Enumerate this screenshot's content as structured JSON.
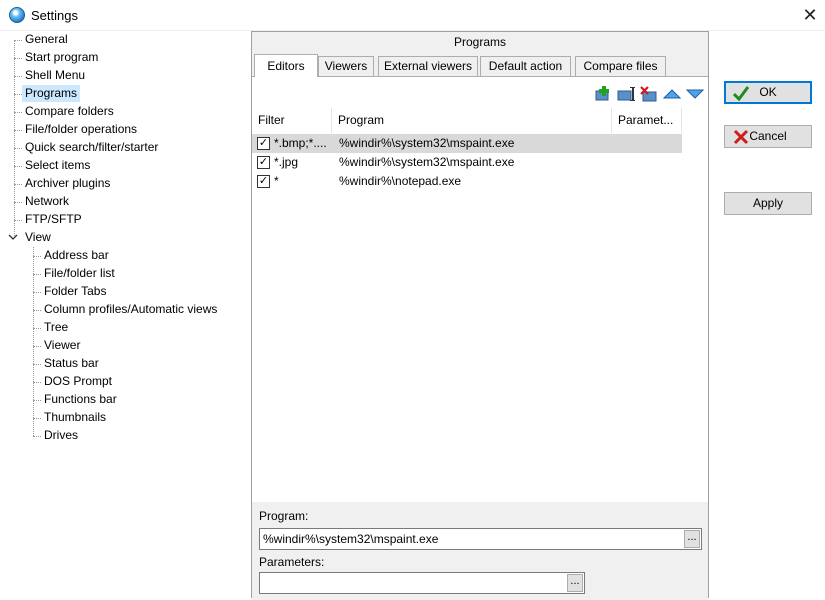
{
  "window": {
    "title": "Settings"
  },
  "tree": {
    "items": [
      {
        "label": "General"
      },
      {
        "label": "Start program"
      },
      {
        "label": "Shell Menu"
      },
      {
        "label": "Programs",
        "selected": true
      },
      {
        "label": "Compare folders"
      },
      {
        "label": "File/folder operations"
      },
      {
        "label": "Quick search/filter/starter"
      },
      {
        "label": "Select items"
      },
      {
        "label": "Archiver plugins"
      },
      {
        "label": "Network"
      },
      {
        "label": "FTP/SFTP"
      },
      {
        "label": "View",
        "expanded": true
      }
    ],
    "view_children": [
      {
        "label": "Address bar"
      },
      {
        "label": "File/folder list"
      },
      {
        "label": "Folder Tabs"
      },
      {
        "label": "Column profiles/Automatic views"
      },
      {
        "label": "Tree"
      },
      {
        "label": "Viewer"
      },
      {
        "label": "Status bar"
      },
      {
        "label": "DOS Prompt"
      },
      {
        "label": "Functions bar"
      },
      {
        "label": "Thumbnails"
      },
      {
        "label": "Drives"
      }
    ]
  },
  "panel": {
    "title": "Programs",
    "tabs": [
      {
        "label": "Editors",
        "active": true
      },
      {
        "label": "Viewers"
      },
      {
        "label": "External viewers"
      },
      {
        "label": "Default action"
      },
      {
        "label": "Compare files"
      }
    ],
    "toolbar_icons": [
      "add-icon",
      "edit-icon",
      "delete-icon",
      "move-up-icon",
      "move-down-icon"
    ],
    "columns": [
      "Filter",
      "Program",
      "Paramet..."
    ],
    "rows": [
      {
        "checked": true,
        "filter": "*.bmp;*....",
        "program": "%windir%\\system32\\mspaint.exe",
        "params": "",
        "selected": true
      },
      {
        "checked": true,
        "filter": "*.jpg",
        "program": "%windir%\\system32\\mspaint.exe",
        "params": ""
      },
      {
        "checked": true,
        "filter": "*",
        "program": "%windir%\\notepad.exe",
        "params": ""
      }
    ],
    "program_label": "Program:",
    "program_value": "%windir%\\system32\\mspaint.exe",
    "parameters_label": "Parameters:",
    "parameters_value": "",
    "browse_label": "..."
  },
  "buttons": {
    "ok": "OK",
    "cancel": "Cancel",
    "apply": "Apply"
  },
  "colors": {
    "selection": "#cce8ff",
    "accent": "#0078d7",
    "ok_check": "#1e8c1e",
    "cancel_x": "#d11a1a"
  }
}
